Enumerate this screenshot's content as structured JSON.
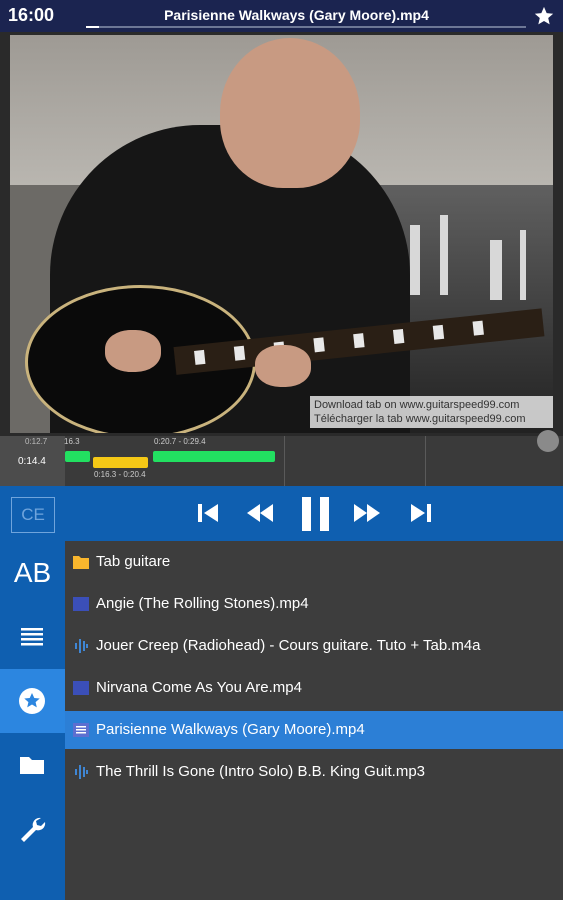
{
  "status": {
    "time": "16:00"
  },
  "header": {
    "title": "Parisienne Walkways (Gary Moore).mp4",
    "progress": 0.03,
    "star_icon": "star-icon"
  },
  "video": {
    "watermark_line1": "Download tab on www.guitarspeed99.com",
    "watermark_line2": "Télécharger la tab www.guitarspeed99.com"
  },
  "timeline": {
    "current_time": "0:14.4",
    "start_label": "0:12.7",
    "segments": [
      {
        "label": "16.3",
        "color": "#22e061"
      },
      {
        "label": "0:16.3 - 0:20.4",
        "color": "#f5c816"
      },
      {
        "label": "0:20.7 - 0:29.4",
        "color": "#22e061"
      }
    ]
  },
  "controls": {
    "ce_label": "CE",
    "buttons": [
      "skip-previous-icon",
      "rewind-icon",
      "pause-icon",
      "fast-forward-icon",
      "skip-next-icon"
    ],
    "accent": "#0f5fb0"
  },
  "sidebar": {
    "ab_label": "AB",
    "items": [
      "list-icon",
      "favorites-star-icon",
      "folder-icon",
      "wrench-icon"
    ],
    "active_item": "favorites-star-icon"
  },
  "files": [
    {
      "name": "Tab guitare",
      "icon": "folder-icon",
      "selected": false
    },
    {
      "name": "Angie (The Rolling Stones).mp4",
      "icon": "video-file-icon",
      "selected": false
    },
    {
      "name": "Jouer Creep (Radiohead) - Cours guitare. Tuto + Tab.m4a",
      "icon": "audio-file-icon",
      "selected": false
    },
    {
      "name": "Nirvana   Come As You Are.mp4",
      "icon": "video-file-icon",
      "selected": false
    },
    {
      "name": "Parisienne Walkways (Gary Moore).mp4",
      "icon": "video-file-icon",
      "selected": true
    },
    {
      "name": "The Thrill Is Gone (Intro Solo)   B.B. King   Guit.mp3",
      "icon": "audio-file-icon",
      "selected": false
    }
  ]
}
